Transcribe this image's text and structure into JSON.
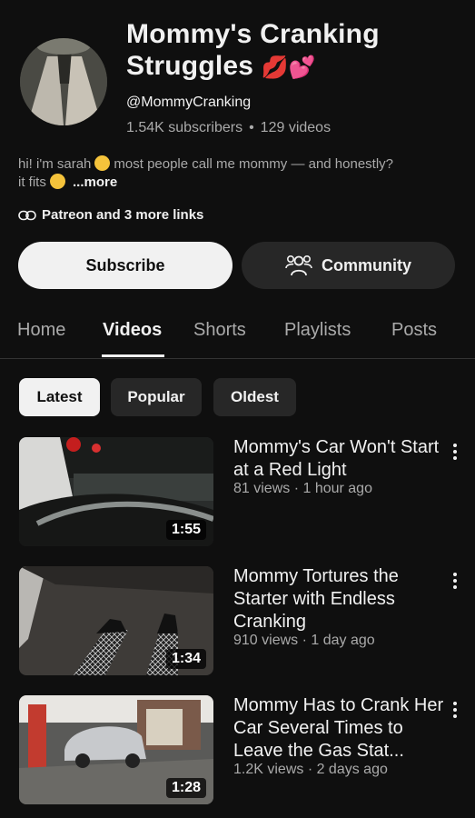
{
  "channel": {
    "name_line1": "Mommy's Cranking",
    "name_line2": "Struggles",
    "name_emoji": "💋💕",
    "handle": "@MommyCranking",
    "subscribers": "1.54K subscribers",
    "videos_count": "129 videos",
    "description_part1": "hi! i'm sarah",
    "description_part2": "most people call me mommy — and honestly?",
    "description_part3": "it fits",
    "more_label": "...more",
    "links_label": "Patreon and 3 more links"
  },
  "actions": {
    "subscribe_label": "Subscribe",
    "community_label": "Community"
  },
  "tabs": [
    {
      "label": "Home",
      "active": false
    },
    {
      "label": "Videos",
      "active": true
    },
    {
      "label": "Shorts",
      "active": false
    },
    {
      "label": "Playlists",
      "active": false
    },
    {
      "label": "Posts",
      "active": false
    }
  ],
  "filters": [
    {
      "label": "Latest",
      "active": true
    },
    {
      "label": "Popular",
      "active": false
    },
    {
      "label": "Oldest",
      "active": false
    }
  ],
  "videos": [
    {
      "title": "Mommy's Car Won't Start at a Red Light",
      "meta": "81 views · 1 hour ago",
      "duration": "1:55"
    },
    {
      "title": "Mommy Tortures the Starter with Endless Cranking",
      "meta": "910 views · 1 day ago",
      "duration": "1:34"
    },
    {
      "title": "Mommy Has to Crank Her Car Several Times to Leave the Gas Stat...",
      "meta": "1.2K views · 2 days ago",
      "duration": "1:28"
    }
  ],
  "icons": {
    "link": "link-icon",
    "community": "people-icon",
    "menu": "more-vert-icon"
  }
}
